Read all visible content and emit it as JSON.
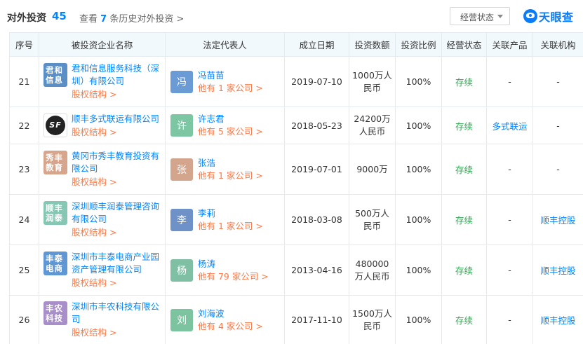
{
  "header": {
    "title": "对外投资",
    "count": "45",
    "history_prefix": "查看",
    "history_count": "7",
    "history_suffix": "条历史对外投资 >",
    "status_filter": "经营状态",
    "logo_text": "天眼查"
  },
  "columns": [
    "序号",
    "被投资企业名称",
    "法定代表人",
    "成立日期",
    "投资数额",
    "投资比例",
    "经营状态",
    "关联产品",
    "关联机构"
  ],
  "rows": [
    {
      "idx": "21",
      "logo_text": "君和信息",
      "logo_color": "#5a8ec6",
      "company": "君和信息服务科技（深圳）有限公司",
      "equity": "股权结构 >",
      "rep_initial": "冯",
      "rep_color": "#6b9bd4",
      "rep_name": "冯苗苗",
      "rep_more": "他有 1 家公司 >",
      "date": "2019-07-10",
      "amount": "1000万人民币",
      "ratio": "100%",
      "status": "存续",
      "product": "-",
      "org": "-"
    },
    {
      "idx": "22",
      "logo_text": "SF",
      "logo_color": "#ffffff",
      "company": "顺丰多式联运有限公司",
      "equity": "股权结构 >",
      "rep_initial": "许",
      "rep_color": "#7cc6a4",
      "rep_name": "许志君",
      "rep_more": "他有 5 家公司 >",
      "date": "2018-05-23",
      "amount": "24200万人民币",
      "ratio": "100%",
      "status": "存续",
      "product": "多式联运",
      "org": "-"
    },
    {
      "idx": "23",
      "logo_text": "秀丰教育",
      "logo_color": "#d7a58c",
      "company": "黄冈市秀丰教育投资有限公司",
      "equity": "股权结构 >",
      "rep_initial": "张",
      "rep_color": "#d4a58d",
      "rep_name": "张浩",
      "rep_more": "他有 1 家公司 >",
      "date": "2019-07-01",
      "amount": "9000万",
      "ratio": "100%",
      "status": "存续",
      "product": "-",
      "org": "-"
    },
    {
      "idx": "24",
      "logo_text": "顺丰润泰",
      "logo_color": "#86c7b3",
      "company": "深圳顺丰润泰管理咨询有限公司",
      "equity": "股权结构 >",
      "rep_initial": "李",
      "rep_color": "#6e91c8",
      "rep_name": "李莉",
      "rep_more": "他有 1 家公司 >",
      "date": "2018-03-08",
      "amount": "500万人民币",
      "ratio": "100%",
      "status": "存续",
      "product": "-",
      "org": "顺丰控股"
    },
    {
      "idx": "25",
      "logo_text": "丰泰电商",
      "logo_color": "#5e97d4",
      "company": "深圳市丰泰电商产业园资产管理有限公司",
      "equity": "股权结构 >",
      "rep_initial": "杨",
      "rep_color": "#7fbfa4",
      "rep_name": "杨涛",
      "rep_more": "他有 79 家公司 >",
      "date": "2013-04-16",
      "amount": "480000万人民币",
      "ratio": "100%",
      "status": "存续",
      "product": "-",
      "org": "顺丰控股"
    },
    {
      "idx": "26",
      "logo_text": "丰农科技",
      "logo_color": "#a98fc9",
      "company": "深圳市丰农科技有限公司",
      "equity": "股权结构 >",
      "rep_initial": "刘",
      "rep_color": "#7cc4a0",
      "rep_name": "刘海波",
      "rep_more": "他有 4 家公司 >",
      "date": "2017-11-10",
      "amount": "1500万人民币",
      "ratio": "100%",
      "status": "存续",
      "product": "-",
      "org": "顺丰控股"
    }
  ]
}
